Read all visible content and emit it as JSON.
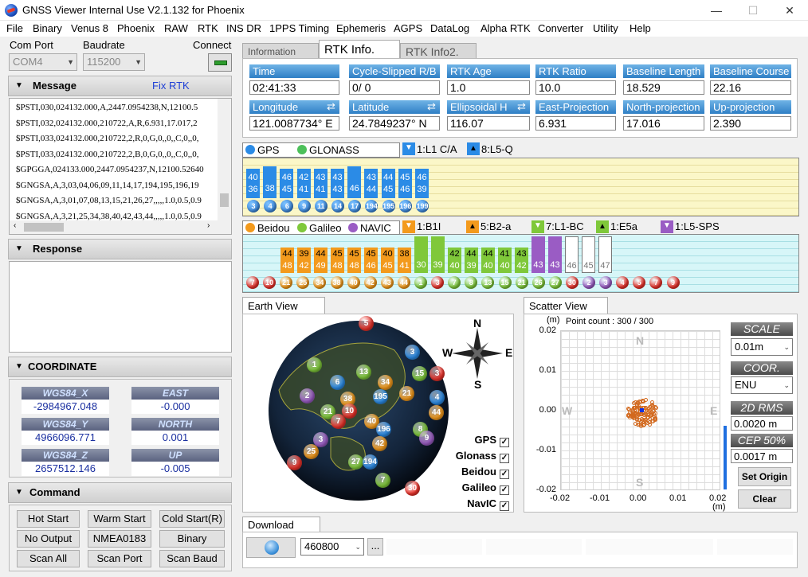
{
  "window": {
    "title": "GNSS Viewer Internal Use V2.1.132 for Phoenix",
    "min": "—",
    "max": "☐",
    "close": "✕"
  },
  "menu": [
    "File",
    "Binary",
    "Venus 8",
    "Phoenix",
    "RAW",
    "RTK",
    "INS DR",
    "1PPS Timing",
    "Ephemeris",
    "AGPS",
    "DataLog",
    "Alpha RTK",
    "Converter",
    "Utility",
    "Help"
  ],
  "conn": {
    "com_label": "Com Port",
    "baud_label": "Baudrate",
    "connect_label": "Connect",
    "com_value": "COM4",
    "baud_value": "115200"
  },
  "message": {
    "title": "Message",
    "link": "Fix RTK",
    "lines": [
      "$PSTI,030,024132.000,A,2447.0954238,N,12100.5",
      "$PSTI,032,024132.000,210722,A,R,6.931,17.017,2",
      "$PSTI,033,024132.000,210722,2,R,0,G,0,,0,,C,0,,0,",
      "$PSTI,033,024132.000,210722,2,B,0,G,0,,0,,C,0,,0,",
      "$GPGGA,024133.000,2447.0954237,N,12100.52640",
      "$GNGSA,A,3,03,04,06,09,11,14,17,194,195,196,19",
      "$GNGSA,A,3,01,07,08,13,15,21,26,27,,,,,1.0,0.5,0.9",
      "$GNGSA,A,3,21,25,34,38,40,42,43,44,,,,,1.0,0.5,0.9"
    ]
  },
  "response": {
    "title": "Response"
  },
  "coordinate": {
    "title": "COORDINATE",
    "items": [
      {
        "label": "WGS84_X",
        "value": "-2984967.048"
      },
      {
        "label": "EAST",
        "value": "-0.000"
      },
      {
        "label": "WGS84_Y",
        "value": "4966096.771"
      },
      {
        "label": "NORTH",
        "value": "0.001"
      },
      {
        "label": "WGS84_Z",
        "value": "2657512.146"
      },
      {
        "label": "UP",
        "value": "-0.005"
      }
    ]
  },
  "command": {
    "title": "Command",
    "buttons": [
      "Hot Start",
      "Warm Start",
      "Cold Start(R)",
      "No Output",
      "NMEA0183",
      "Binary",
      "Scan All",
      "Scan Port",
      "Scan Baud"
    ]
  },
  "tabs": [
    "Information",
    "RTK Info.",
    "RTK Info2."
  ],
  "rtk": {
    "fields": [
      {
        "label": "Time",
        "value": "02:41:33"
      },
      {
        "label": "Cycle-Slipped R/B",
        "value": "0/    0"
      },
      {
        "label": "RTK  Age",
        "value": "1.0"
      },
      {
        "label": "RTK  Ratio",
        "value": "10.0"
      },
      {
        "label": "Baseline  Length",
        "value": "18.529"
      },
      {
        "label": "Baseline  Course",
        "value": "22.16"
      },
      {
        "label": "Longitude",
        "value": "121.0087734° E"
      },
      {
        "label": "Latitude",
        "value": "24.7849237° N"
      },
      {
        "label": "Ellipsoidal H",
        "value": "116.07"
      },
      {
        "label": "East-Projection",
        "value": "6.931"
      },
      {
        "label": "North-projection",
        "value": "17.016"
      },
      {
        "label": "Up-projection",
        "value": "2.390"
      }
    ]
  },
  "gps_chart": {
    "legend": [
      "GPS",
      "GLONASS"
    ],
    "bands": [
      "1:L1 C/A",
      "8:L5-Q"
    ],
    "bars": [
      {
        "top": "40",
        "bot": "36",
        "sv": "3"
      },
      {
        "top": "",
        "bot": "38",
        "sv": "4"
      },
      {
        "top": "46",
        "bot": "45",
        "sv": "6"
      },
      {
        "top": "42",
        "bot": "41",
        "sv": "9"
      },
      {
        "top": "43",
        "bot": "41",
        "sv": "11"
      },
      {
        "top": "43",
        "bot": "43",
        "sv": "14"
      },
      {
        "top": "",
        "bot": "46",
        "sv": "17"
      },
      {
        "top": "43",
        "bot": "44",
        "sv": "194"
      },
      {
        "top": "44",
        "bot": "45",
        "sv": "195"
      },
      {
        "top": "45",
        "bot": "46",
        "sv": "196"
      },
      {
        "top": "46",
        "bot": "39",
        "sv": "199"
      }
    ]
  },
  "bd_chart": {
    "legend": [
      "Beidou",
      "Galileo",
      "NAVIC"
    ],
    "bands": [
      "1:B1I",
      "5:B2-a",
      "7:L1-BC",
      "1:E5a",
      "1:L5-SPS"
    ],
    "bars": [
      {
        "top": "44",
        "bot": "48",
        "c": "o"
      },
      {
        "top": "39",
        "bot": "42",
        "c": "o"
      },
      {
        "top": "44",
        "bot": "49",
        "c": "o"
      },
      {
        "top": "45",
        "bot": "48",
        "c": "o"
      },
      {
        "top": "45",
        "bot": "48",
        "c": "o"
      },
      {
        "top": "45",
        "bot": "46",
        "c": "o"
      },
      {
        "top": "40",
        "bot": "45",
        "c": "o"
      },
      {
        "top": "38",
        "bot": "41",
        "c": "o"
      },
      {
        "top": "",
        "bot": "30",
        "c": "g"
      },
      {
        "top": "",
        "bot": "39",
        "c": "g"
      },
      {
        "top": "42",
        "bot": "40",
        "c": "g"
      },
      {
        "top": "44",
        "bot": "39",
        "c": "g"
      },
      {
        "top": "44",
        "bot": "40",
        "c": "g"
      },
      {
        "top": "41",
        "bot": "40",
        "c": "g"
      },
      {
        "top": "43",
        "bot": "42",
        "c": "g"
      },
      {
        "top": "",
        "bot": "43",
        "c": "p"
      },
      {
        "top": "",
        "bot": "43",
        "c": "p"
      },
      {
        "top": "",
        "bot": "46",
        "c": "w"
      },
      {
        "top": "",
        "bot": "45",
        "c": "w"
      },
      {
        "top": "",
        "bot": "47",
        "c": "w"
      }
    ],
    "svs": [
      {
        "n": "7",
        "c": "r"
      },
      {
        "n": "10",
        "c": "r"
      },
      {
        "n": "21",
        "c": "o"
      },
      {
        "n": "25",
        "c": "o"
      },
      {
        "n": "34",
        "c": "o"
      },
      {
        "n": "38",
        "c": "o"
      },
      {
        "n": "40",
        "c": "o"
      },
      {
        "n": "42",
        "c": "o"
      },
      {
        "n": "43",
        "c": "o"
      },
      {
        "n": "44",
        "c": "o"
      },
      {
        "n": "1",
        "c": "g"
      },
      {
        "n": "3",
        "c": "r"
      },
      {
        "n": "7",
        "c": "g"
      },
      {
        "n": "8",
        "c": "g"
      },
      {
        "n": "13",
        "c": "g"
      },
      {
        "n": "15",
        "c": "g"
      },
      {
        "n": "21",
        "c": "g"
      },
      {
        "n": "26",
        "c": "g"
      },
      {
        "n": "27",
        "c": "g"
      },
      {
        "n": "30",
        "c": "r"
      },
      {
        "n": "2",
        "c": "p"
      },
      {
        "n": "3",
        "c": "p"
      },
      {
        "n": "4",
        "c": "r"
      },
      {
        "n": "5",
        "c": "r"
      },
      {
        "n": "7",
        "c": "r"
      },
      {
        "n": "9",
        "c": "r"
      }
    ]
  },
  "earth": {
    "title": "Earth View",
    "checks": [
      "GPS",
      "Glonass",
      "Beidou",
      "Galileo",
      "NavIC"
    ],
    "compass": {
      "n": "N",
      "s": "S",
      "e": "E",
      "w": "W"
    }
  },
  "scatter": {
    "title": "Scatter View",
    "unit": "(m)",
    "point_count": "Point count : 300 / 300",
    "yticks": [
      "0.02",
      "0.01",
      "0.00",
      "-0.01",
      "-0.02"
    ],
    "xticks": [
      "-0.02",
      "-0.01",
      "0.00",
      "0.01",
      "0.02"
    ],
    "xunit": "(m)",
    "n": "N",
    "s": "S",
    "e": "E",
    "w": "W",
    "scale_label": "SCALE",
    "scale_value": "0.01m",
    "coor_label": "COOR.",
    "coor_value": "ENU",
    "rms_label": "2D RMS",
    "rms_value": "0.0020 m",
    "cep_label": "CEP 50%",
    "cep_value": "0.0017 m",
    "set_origin": "Set Origin",
    "clear": "Clear"
  },
  "download": {
    "title": "Download",
    "baud": "460800",
    "browse": "..."
  }
}
